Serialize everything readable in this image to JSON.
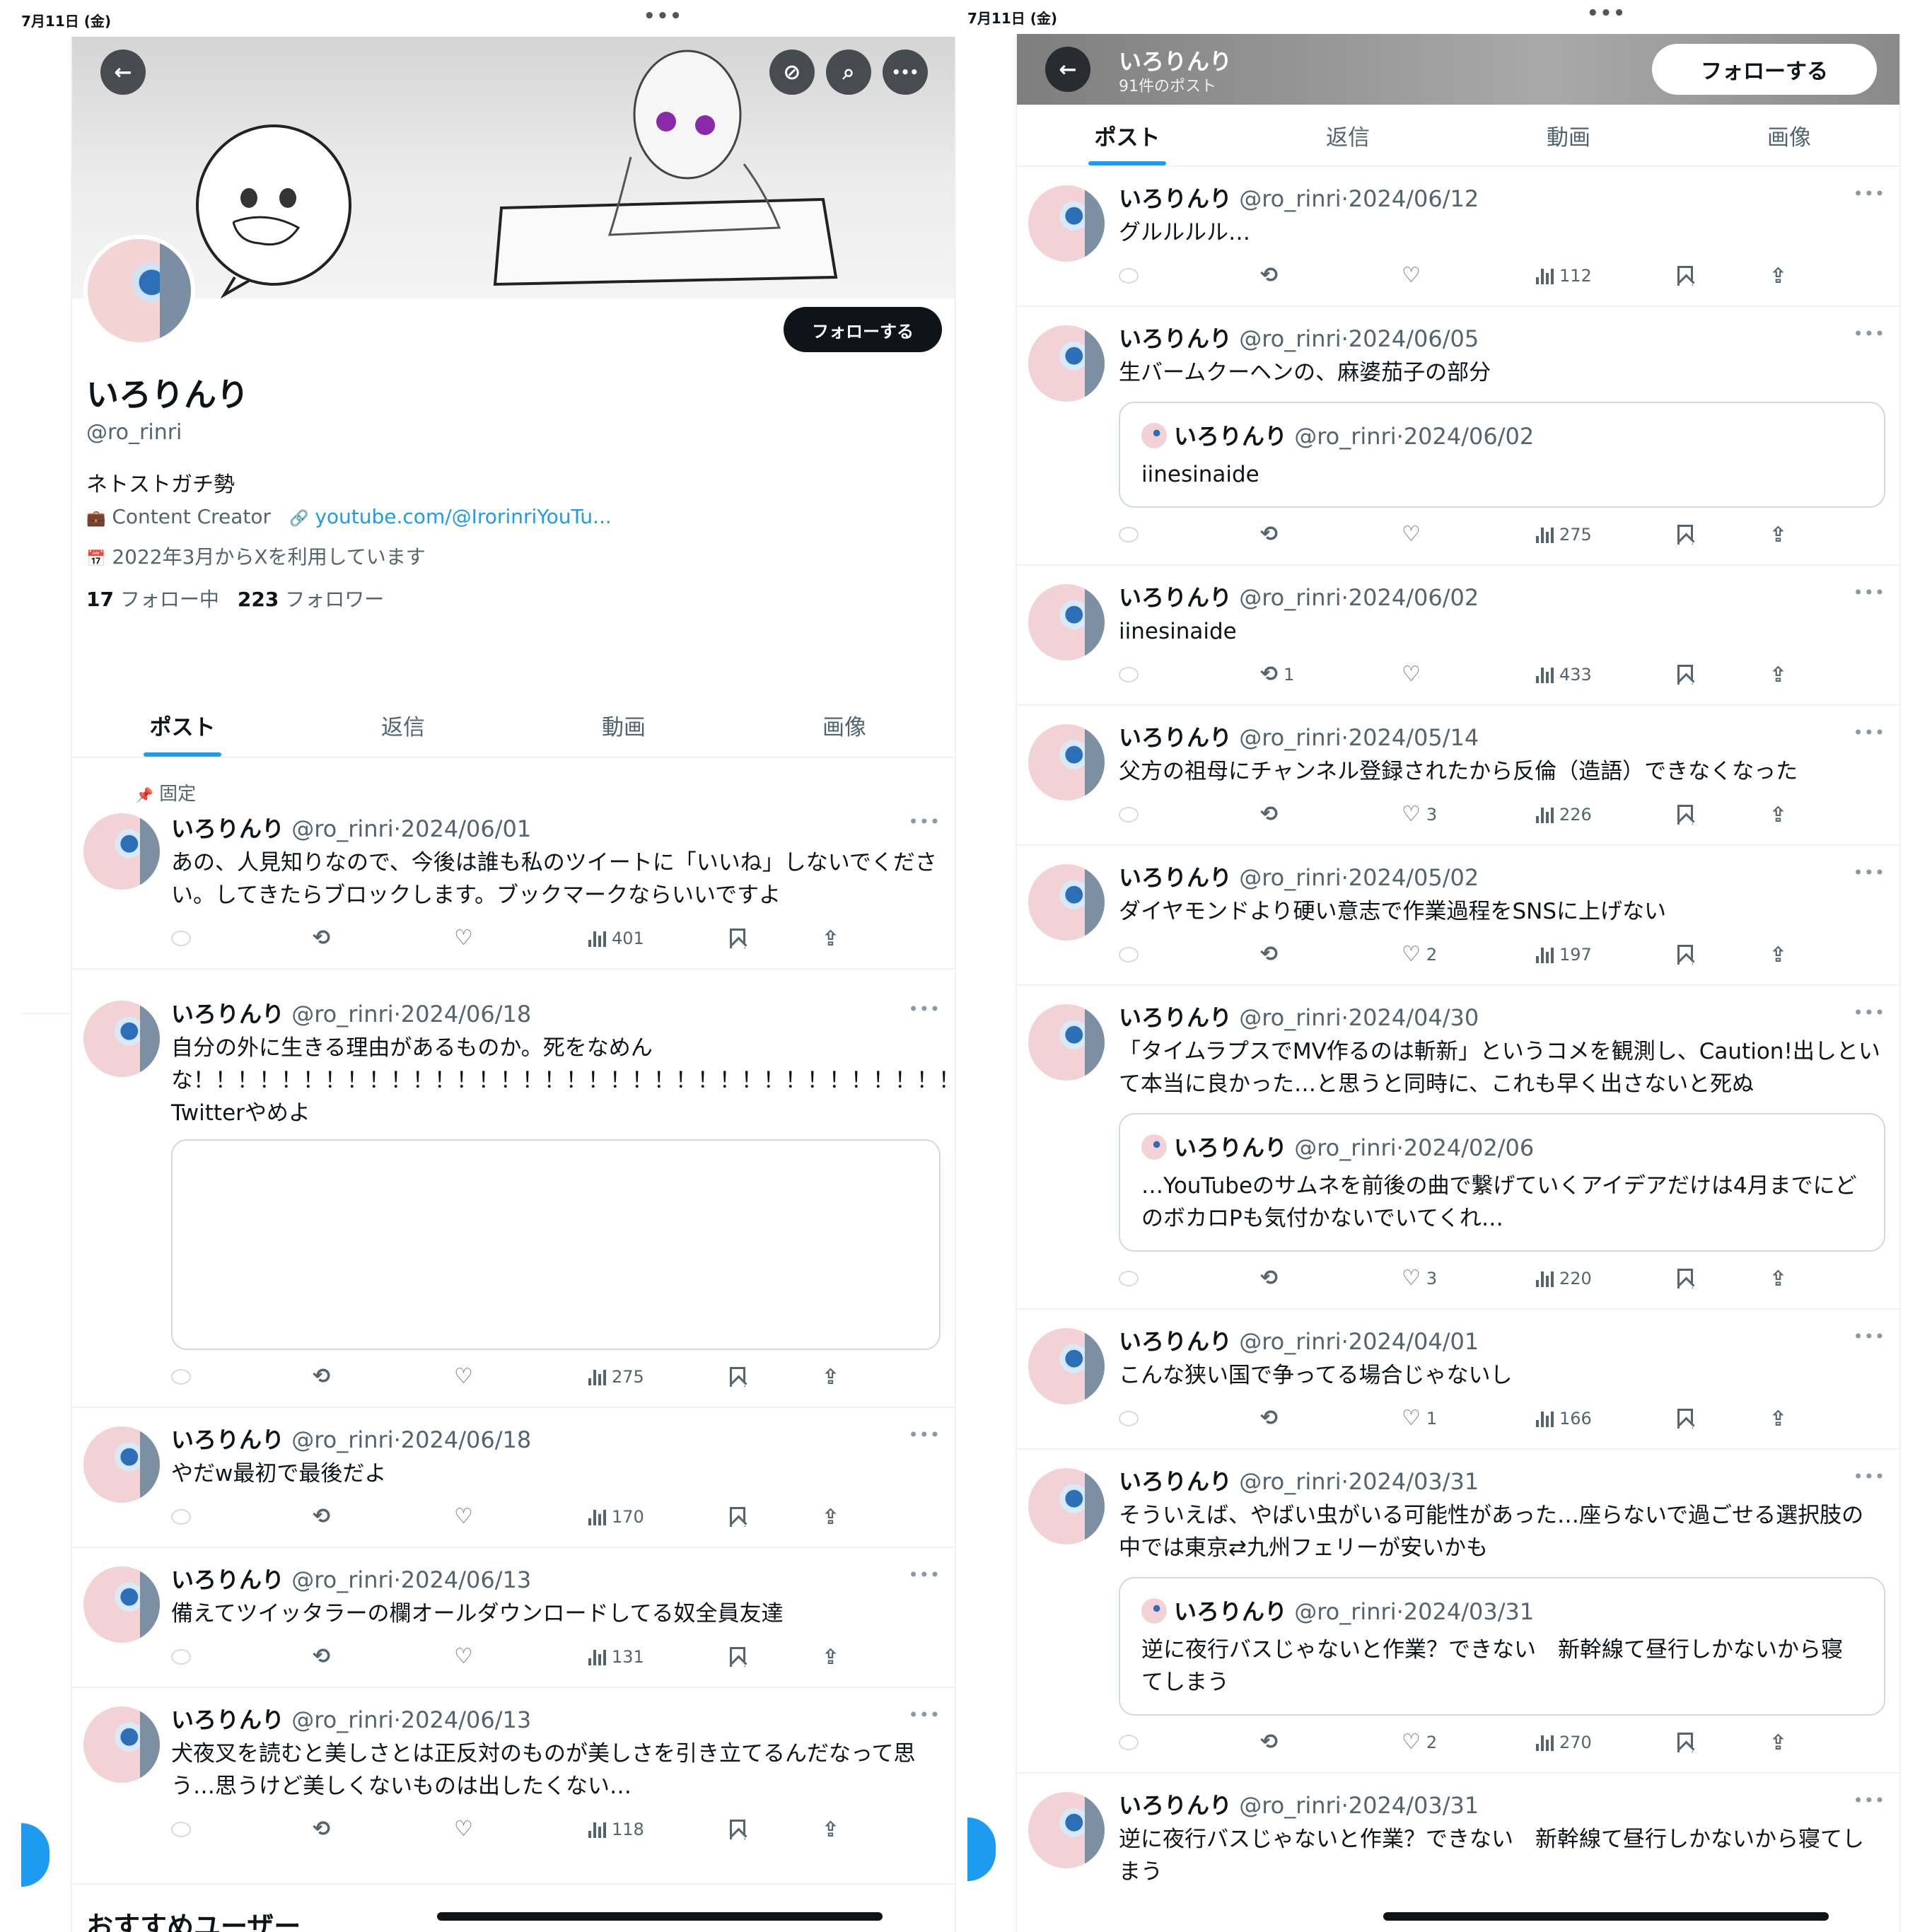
{
  "status_bar": {
    "date": "7月11日 (金)",
    "dots": "•••"
  },
  "left": {
    "banner_buttons": {
      "back": "←",
      "hide": "⊘",
      "search": "⌕",
      "more": "•••"
    },
    "follow_label": "フォローする",
    "name": "いろりんり",
    "handle": "@ro_rinri",
    "bio": "ネトストガチ勢",
    "category": "Content Creator",
    "link": "youtube.com/@IrorinriYouTu...",
    "joined": "2022年3月からXを利用しています",
    "following_count": "17",
    "following_label": "フォロー中",
    "followers_count": "223",
    "followers_label": "フォロワー",
    "tabs": [
      "ポスト",
      "返信",
      "動画",
      "画像"
    ],
    "pinned_label": "固定",
    "posts": [
      {
        "name": "いろりんり",
        "handle": "@ro_rinri",
        "date": "2024/06/01",
        "text": "あの、人見知りなので、今後は誰も私のツイートに「いいね」しないでください。してきたらブロックします。ブックマークならいいですよ",
        "retweets": "",
        "likes": "",
        "views": "401"
      },
      {
        "name": "いろりんり",
        "handle": "@ro_rinri",
        "date": "2024/06/18",
        "text": "自分の外に生きる理由があるものか。死をなめんな！！！！！！！！！！！！！！！！！！！！！！！！！！！！！！！！！！！！！！！！！！！！Twitterやめよ",
        "retweets": "",
        "likes": "",
        "views": "275"
      },
      {
        "name": "いろりんり",
        "handle": "@ro_rinri",
        "date": "2024/06/18",
        "text": "やだw最初で最後だよ",
        "retweets": "",
        "likes": "",
        "views": "170"
      },
      {
        "name": "いろりんり",
        "handle": "@ro_rinri",
        "date": "2024/06/13",
        "text": "備えてツイッタラーの欄オールダウンロードしてる奴全員友達",
        "retweets": "",
        "likes": "",
        "views": "131"
      },
      {
        "name": "いろりんり",
        "handle": "@ro_rinri",
        "date": "2024/06/13",
        "text": "犬夜叉を読むと美しさとは正反対のものが美しさを引き立てるんだなって思う…思うけど美しくないものは出したくない…",
        "retweets": "",
        "likes": "",
        "views": "118"
      }
    ],
    "recommend_title": "おすすめユーザー"
  },
  "right": {
    "back": "←",
    "name": "いろりんり",
    "post_count": "91件のポスト",
    "follow_label": "フォローする",
    "tabs": [
      "ポスト",
      "返信",
      "動画",
      "画像"
    ],
    "posts": [
      {
        "name": "いろりんり",
        "handle": "@ro_rinri",
        "date": "2024/06/12",
        "text": "グルルルル…",
        "retweets": "",
        "likes": "",
        "views": "112"
      },
      {
        "name": "いろりんり",
        "handle": "@ro_rinri",
        "date": "2024/06/05",
        "text": "生バームクーヘンの、麻婆茄子の部分",
        "quote": {
          "name": "いろりんり",
          "handle": "@ro_rinri",
          "date": "2024/06/02",
          "text": "iinesinaide"
        },
        "retweets": "",
        "likes": "",
        "views": "275"
      },
      {
        "name": "いろりんり",
        "handle": "@ro_rinri",
        "date": "2024/06/02",
        "text": "iinesinaide",
        "retweets": "1",
        "likes": "",
        "views": "433"
      },
      {
        "name": "いろりんり",
        "handle": "@ro_rinri",
        "date": "2024/05/14",
        "text": "父方の祖母にチャンネル登録されたから反倫（造語）できなくなった",
        "retweets": "",
        "likes": "3",
        "views": "226"
      },
      {
        "name": "いろりんり",
        "handle": "@ro_rinri",
        "date": "2024/05/02",
        "text": "ダイヤモンドより硬い意志で作業過程をSNSに上げない",
        "retweets": "",
        "likes": "2",
        "views": "197"
      },
      {
        "name": "いろりんり",
        "handle": "@ro_rinri",
        "date": "2024/04/30",
        "text": "「タイムラプスでMV作るのは斬新」というコメを観測し、Caution!出しといて本当に良かった…と思うと同時に、これも早く出さないと死ぬ",
        "quote": {
          "name": "いろりんり",
          "handle": "@ro_rinri",
          "date": "2024/02/06",
          "text": "…YouTubeのサムネを前後の曲で繋げていくアイデアだけは4月までにどのボカロPも気付かないでいてくれ…"
        },
        "retweets": "",
        "likes": "3",
        "views": "220"
      },
      {
        "name": "いろりんり",
        "handle": "@ro_rinri",
        "date": "2024/04/01",
        "text": "こんな狭い国で争ってる場合じゃないし",
        "retweets": "",
        "likes": "1",
        "views": "166"
      },
      {
        "name": "いろりんり",
        "handle": "@ro_rinri",
        "date": "2024/03/31",
        "text": "そういえば、やばい虫がいる可能性があった…座らないで過ごせる選択肢の中では東京⇄九州フェリーが安いかも",
        "quote": {
          "name": "いろりんり",
          "handle": "@ro_rinri",
          "date": "2024/03/31",
          "text": "逆に夜行バスじゃないと作業？できない　新幹線て昼行しかないから寝てしまう"
        },
        "retweets": "",
        "likes": "2",
        "views": "270"
      },
      {
        "name": "いろりんり",
        "handle": "@ro_rinri",
        "date": "2024/03/31",
        "text": "逆に夜行バスじゃないと作業？できない　新幹線て昼行しかないから寝てしまう",
        "retweets": "",
        "likes": "",
        "views": ""
      }
    ]
  },
  "icons": {
    "retweet": "⟲",
    "like": "♡",
    "share": "⇪",
    "more": "•••",
    "pin": "📌",
    "briefcase": "💼",
    "link": "🔗",
    "calendar": "📅"
  },
  "colors": {
    "accent": "#1d9bf0",
    "text": "#0f1419",
    "muted": "#536471",
    "border": "#eff3f4"
  }
}
